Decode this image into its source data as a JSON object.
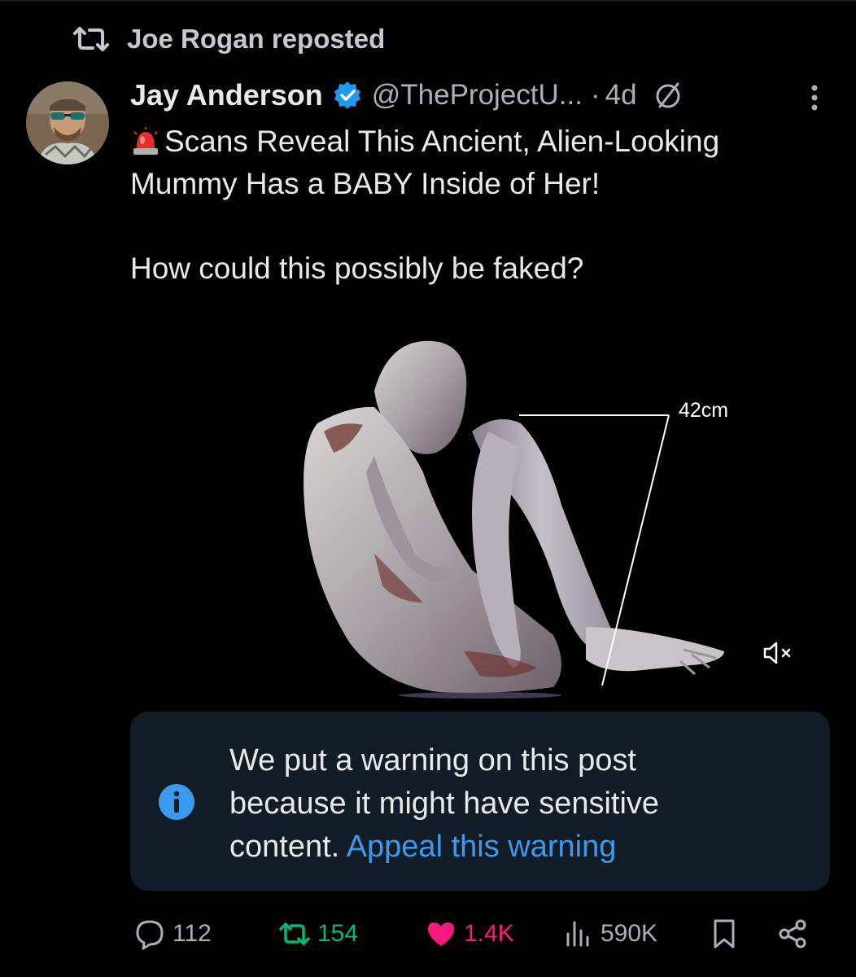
{
  "repost_header": {
    "text": "Joe Rogan reposted"
  },
  "author": {
    "display_name": "Jay Anderson",
    "handle": "@TheProjectU...",
    "separator": "·",
    "time": "4d"
  },
  "tweet": {
    "emoji": "🚨",
    "line1": "Scans Reveal This Ancient, Alien-Looking",
    "line2": "Mummy Has a BABY Inside of Her!",
    "line3": "How could this possibly be faked?"
  },
  "media": {
    "measurement_label": "42cm",
    "muted": true
  },
  "warning": {
    "line1": "We put a warning on this post",
    "line2": "because it might have sensitive",
    "line3_prefix": "content.",
    "appeal_link": "Appeal this warning"
  },
  "actions": {
    "replies": "112",
    "reposts": "154",
    "likes": "1.4K",
    "views": "590K"
  },
  "colors": {
    "background": "#000000",
    "warning_bg": "#121c26",
    "link": "#3b9af0",
    "repost_active": "#00ba7c",
    "like_active": "#f91880",
    "verified": "#1d9bf0"
  },
  "icons": [
    "repost-icon",
    "verified-badge-icon",
    "null-circle-icon",
    "more-icon",
    "siren-emoji-icon",
    "mute-icon",
    "info-icon",
    "reply-icon",
    "heart-icon",
    "views-icon",
    "bookmark-icon",
    "share-icon"
  ]
}
